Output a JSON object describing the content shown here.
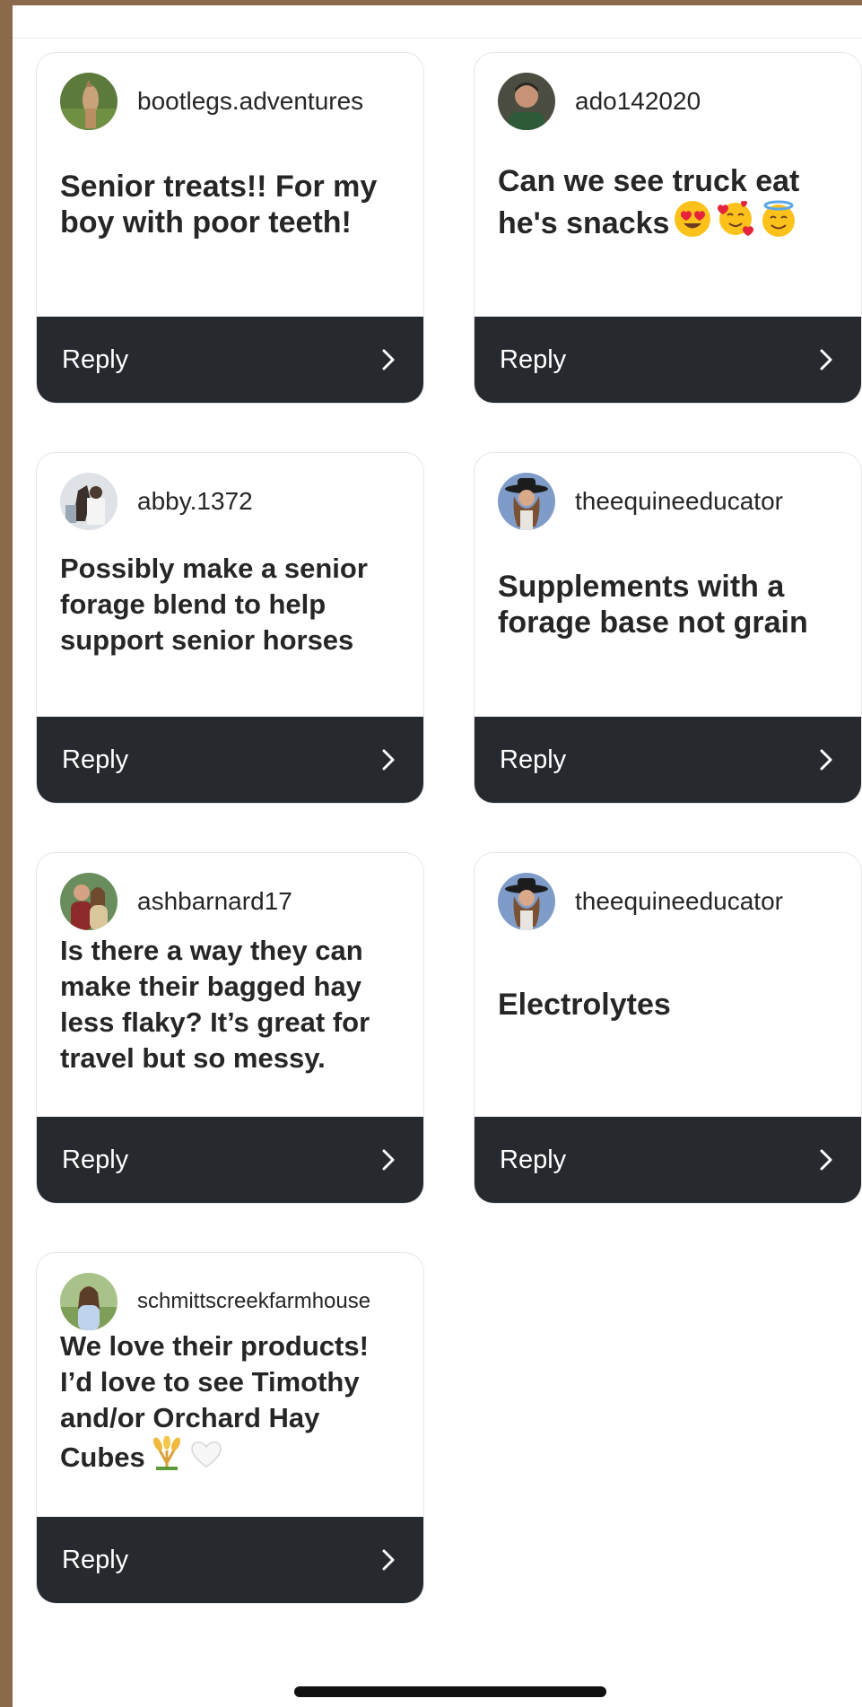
{
  "reply_label": "Reply",
  "cards": [
    {
      "username": "bootlegs.adventures",
      "comment": "Senior treats!! For my boy with poor teeth!",
      "avatar": "horse-photo"
    },
    {
      "username": "ado142020",
      "comment": "Can we see truck eat he's snacks",
      "avatar": "man-photo"
    },
    {
      "username": "abby.1372",
      "comment": "Possibly make a senior forage blend to help support senior horses",
      "avatar": "horse-and-rider-photo"
    },
    {
      "username": "theequineeducator",
      "comment": "Supplements with a forage base not grain",
      "avatar": "cowgirl-photo"
    },
    {
      "username": "ashbarnard17",
      "comment": "Is there a way they can make their bagged hay less flaky? It’s great for travel but so messy.",
      "avatar": "couple-photo"
    },
    {
      "username": "theequineeducator",
      "comment": "Electrolytes",
      "avatar": "cowgirl-photo"
    },
    {
      "username": "schmittscreekfarmhouse",
      "comment": "We love their products! I’d love to see Timothy and/or Orchard Hay Cubes",
      "avatar": "woman-field-photo"
    }
  ],
  "emojis": {
    "card_2": [
      "heart-eyes-emoji",
      "smiling-hearts-emoji",
      "halo-emoji"
    ],
    "card_7": [
      "sheaf-emoji",
      "white-heart-emoji"
    ]
  },
  "colors": {
    "reply_bar": "#262a2f",
    "card_border": "#e6e6e6",
    "text": "#262626",
    "frame": "#8B6A4B"
  }
}
